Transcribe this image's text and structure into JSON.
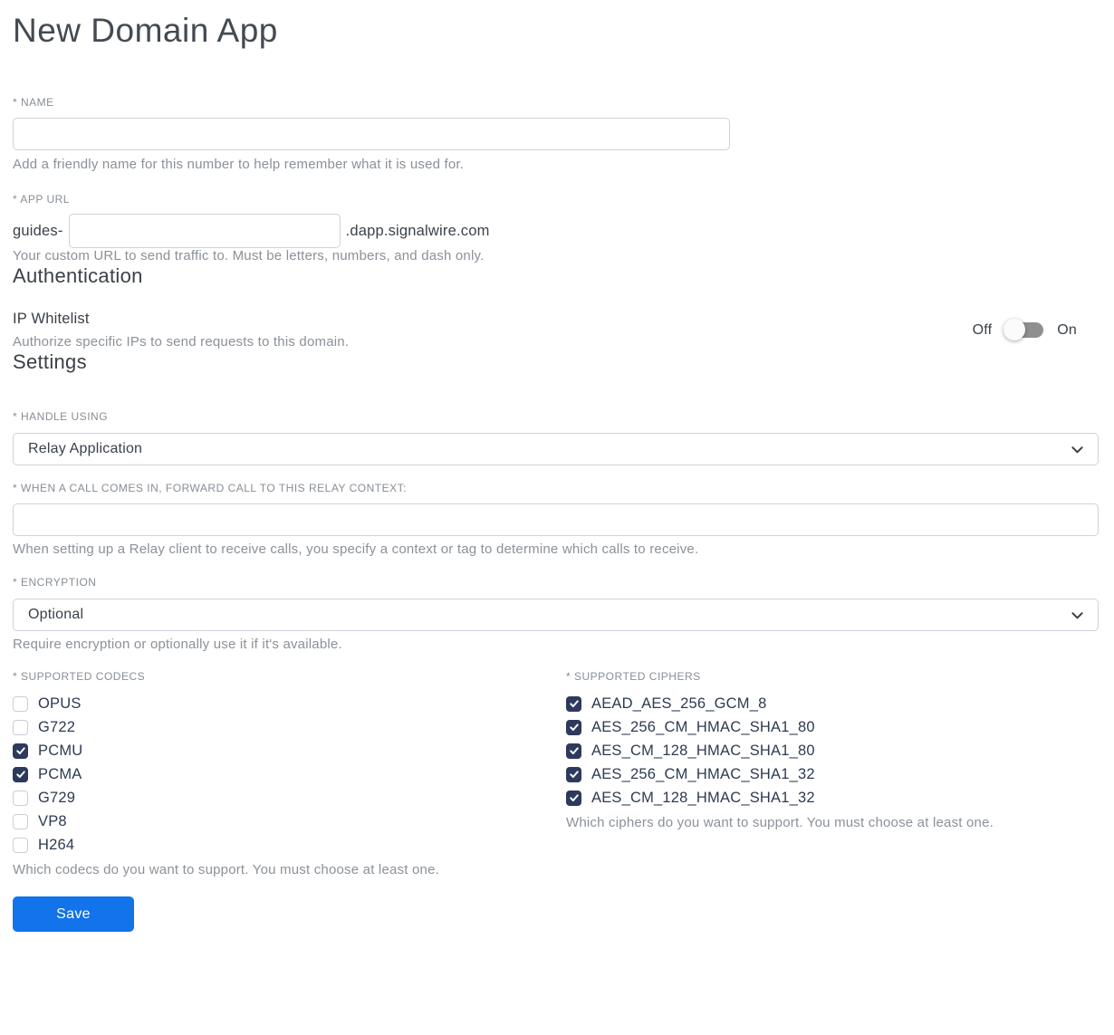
{
  "page": {
    "title": "New Domain App"
  },
  "name_field": {
    "label": "* NAME",
    "value": "",
    "helper": "Add a friendly name for this number to help remember what it is used for."
  },
  "app_url_field": {
    "label": "* APP URL",
    "prefix": "guides-",
    "value": "",
    "suffix": ".dapp.signalwire.com",
    "helper": "Your custom URL to send traffic to. Must be letters, numbers, and dash only."
  },
  "authentication": {
    "heading": "Authentication",
    "ip_whitelist": {
      "label": "IP Whitelist",
      "helper": "Authorize specific IPs to send requests to this domain.",
      "off_label": "Off",
      "on_label": "On",
      "state": "off"
    }
  },
  "settings": {
    "heading": "Settings",
    "handle_using": {
      "label": "* HANDLE USING",
      "value": "Relay Application"
    },
    "relay_context": {
      "label": "* WHEN A CALL COMES IN, FORWARD CALL TO THIS RELAY CONTEXT:",
      "value": "",
      "helper": "When setting up a Relay client to receive calls, you specify a context or tag to determine which calls to receive."
    },
    "encryption": {
      "label": "* ENCRYPTION",
      "value": "Optional",
      "helper": "Require encryption or optionally use it if it's available."
    },
    "codecs": {
      "label": "* SUPPORTED CODECS",
      "helper": "Which codecs do you want to support. You must choose at least one.",
      "options": [
        {
          "label": "OPUS",
          "checked": false
        },
        {
          "label": "G722",
          "checked": false
        },
        {
          "label": "PCMU",
          "checked": true
        },
        {
          "label": "PCMA",
          "checked": true
        },
        {
          "label": "G729",
          "checked": false
        },
        {
          "label": "VP8",
          "checked": false
        },
        {
          "label": "H264",
          "checked": false
        }
      ]
    },
    "ciphers": {
      "label": "* SUPPORTED CIPHERS",
      "helper": "Which ciphers do you want to support. You must choose at least one.",
      "options": [
        {
          "label": "AEAD_AES_256_GCM_8",
          "checked": true
        },
        {
          "label": "AES_256_CM_HMAC_SHA1_80",
          "checked": true
        },
        {
          "label": "AES_CM_128_HMAC_SHA1_80",
          "checked": true
        },
        {
          "label": "AES_256_CM_HMAC_SHA1_32",
          "checked": true
        },
        {
          "label": "AES_CM_128_HMAC_SHA1_32",
          "checked": true
        }
      ]
    }
  },
  "actions": {
    "save_label": "Save"
  },
  "colors": {
    "accent_blue": "#1273eb",
    "checkbox_navy": "#2d3a5d",
    "toggle_track_gray": "#8f8f8f",
    "label_gray": "#878e96",
    "helper_gray": "#8b9199",
    "dark_text": "#3a4047"
  }
}
